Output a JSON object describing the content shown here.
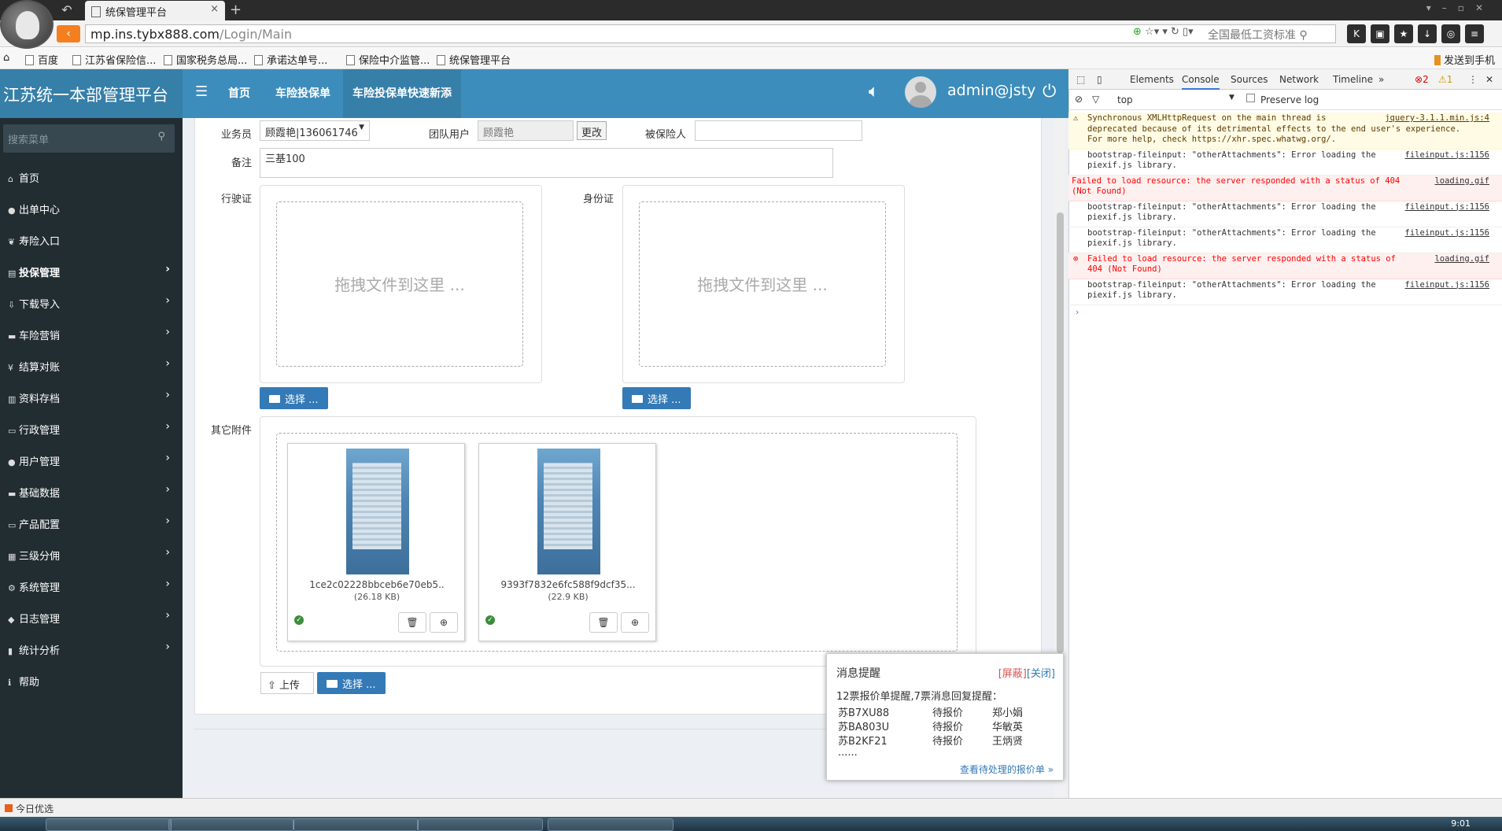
{
  "browser": {
    "tab_title": "统保管理平台",
    "url_host": "mp.ins.tybx888.com",
    "url_path": "/Login/Main",
    "search_hint": "全国最低工资标准",
    "send_to_phone": "发送到手机",
    "bookmarks": [
      "百度",
      "江苏省保险信...",
      "国家税务总局...",
      "承诺达单号...",
      "保险中介监管...",
      "统保管理平台"
    ]
  },
  "header": {
    "brand": "江苏统一本部管理平台",
    "nav": [
      "首页",
      "车险投保单",
      "车险投保单快速新添"
    ],
    "username": "admin@jsty"
  },
  "sidebar": {
    "search_placeholder": "搜索菜单",
    "items": [
      {
        "label": "首页",
        "icon": "home-icon"
      },
      {
        "label": "出单中心",
        "icon": "globe-icon"
      },
      {
        "label": "寿险入口",
        "icon": "leaf-icon"
      },
      {
        "label": "投保管理",
        "icon": "file-icon"
      },
      {
        "label": "下载导入",
        "icon": "download-icon"
      },
      {
        "label": "车险营销",
        "icon": "car-icon"
      },
      {
        "label": "结算对账",
        "icon": "yen-icon"
      },
      {
        "label": "资料存档",
        "icon": "book-icon"
      },
      {
        "label": "行政管理",
        "icon": "briefcase-icon"
      },
      {
        "label": "用户管理",
        "icon": "user-icon"
      },
      {
        "label": "基础数据",
        "icon": "hdd-icon"
      },
      {
        "label": "产品配置",
        "icon": "folder-icon"
      },
      {
        "label": "三级分佣",
        "icon": "grid-icon"
      },
      {
        "label": "系统管理",
        "icon": "gear-icon"
      },
      {
        "label": "日志管理",
        "icon": "tag-icon"
      },
      {
        "label": "统计分析",
        "icon": "chart-icon"
      },
      {
        "label": "帮助",
        "icon": "info-icon"
      }
    ]
  },
  "form": {
    "salesman_label": "业务员",
    "salesman_value": "顾霞艳|136061746",
    "team_label": "团队用户",
    "team_value": "顾霞艳",
    "change_btn": "更改",
    "insured_label": "被保险人",
    "insured_value": "",
    "remark_label": "备注",
    "remark_value": "三基100",
    "license_label": "行驶证",
    "idcard_label": "身份证",
    "dropzone_text": "拖拽文件到这里 ...",
    "choose_btn": "选择 ...",
    "other_label": "其它附件",
    "upload_btn": "上传",
    "files": [
      {
        "name": "1ce2c02228bbceb6e70eb5..",
        "size": "(26.18 KB)"
      },
      {
        "name": "9393f7832e6fc588f9dcf35...",
        "size": "(22.9 KB)"
      }
    ]
  },
  "notification": {
    "title": "消息提醒",
    "block": "[屏蔽]",
    "close": "[关闭]",
    "summary": "12票报价单提醒,7票消息回复提醒：",
    "rows": [
      {
        "plate": "苏B7XU88",
        "status": "待报价",
        "person": "郑小娟"
      },
      {
        "plate": "苏BA803U",
        "status": "待报价",
        "person": "华敏英"
      },
      {
        "plate": "苏B2KF21",
        "status": "待报价",
        "person": "王炳贤"
      }
    ],
    "ellipsis": "......",
    "link": "查看待处理的报价单 »"
  },
  "devtools": {
    "tabs": [
      "Elements",
      "Console",
      "Sources",
      "Network",
      "Timeline"
    ],
    "error_count": "2",
    "warn_count": "1",
    "context": "top",
    "preserve_log": "Preserve log",
    "messages": [
      {
        "type": "warn",
        "text": "Synchronous XMLHttpRequest on the main thread is\ndeprecated because of its detrimental effects to the end user's experience.\nFor more help, check https://xhr.spec.whatwg.org/.",
        "src": "jquery-3.1.1.min.js:4"
      },
      {
        "type": "log",
        "text": "bootstrap-fileinput: \"otherAttachments\": Error loading the\npiexif.js library.",
        "src": "fileinput.js:1156"
      },
      {
        "type": "err",
        "text": "Failed to load resource: the server responded with a status of 404\n(Not Found)",
        "src": "loading.gif"
      },
      {
        "type": "log",
        "text": "bootstrap-fileinput: \"otherAttachments\": Error loading the\npiexif.js library.",
        "src": "fileinput.js:1156"
      },
      {
        "type": "log",
        "text": "bootstrap-fileinput: \"otherAttachments\": Error loading the\npiexif.js library.",
        "src": "fileinput.js:1156"
      },
      {
        "type": "err",
        "text": "Failed to load resource: the server responded with a status of\n404 (Not Found)",
        "src": "loading.gif"
      },
      {
        "type": "log",
        "text": "bootstrap-fileinput: \"otherAttachments\": Error loading the\npiexif.js library.",
        "src": "fileinput.js:1156"
      }
    ]
  },
  "status": {
    "left": "今日优选",
    "clock": "9:01"
  }
}
